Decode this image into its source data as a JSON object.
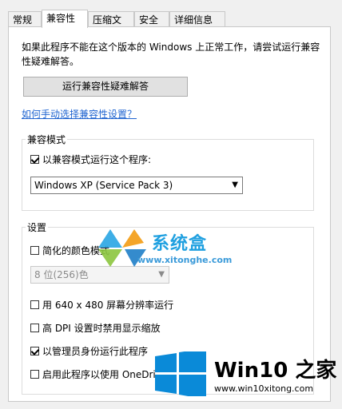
{
  "tabs": [
    {
      "label": "常规"
    },
    {
      "label": "兼容性"
    },
    {
      "label": "压缩文件"
    },
    {
      "label": "安全"
    },
    {
      "label": "详细信息"
    }
  ],
  "description": "如果此程序不能在这个版本的 Windows 上正常工作，请尝试运行兼容性疑难解答。",
  "troubleshoot_button": "运行兼容性疑难解答",
  "manual_link": "如何手动选择兼容性设置？",
  "compat_mode": {
    "title": "兼容模式",
    "checkbox_label": "以兼容模式运行这个程序:",
    "checked": true,
    "selected_os": "Windows XP (Service Pack 3)"
  },
  "settings": {
    "title": "设置",
    "reduced_color": {
      "label": "简化的颜色模式",
      "checked": false
    },
    "color_select": "8 位(256)色",
    "res_640": {
      "label": "用 640 x 480 屏幕分辨率运行",
      "checked": false
    },
    "high_dpi": {
      "label": "高 DPI 设置时禁用显示缩放",
      "checked": false
    },
    "run_admin": {
      "label": "以管理员身份运行此程序",
      "checked": true
    },
    "onedrive": {
      "label": "启用此程序以使用 OneDri",
      "checked": false
    }
  },
  "watermarks": {
    "site1_name": "系统盒",
    "site1_url": "www.xitonghe.com",
    "site2_name": "Win10 之家",
    "site2_url": "www.win10xitong.com"
  },
  "colors": {
    "link": "#1f64d0",
    "win_blue": "#0a8ad8"
  }
}
